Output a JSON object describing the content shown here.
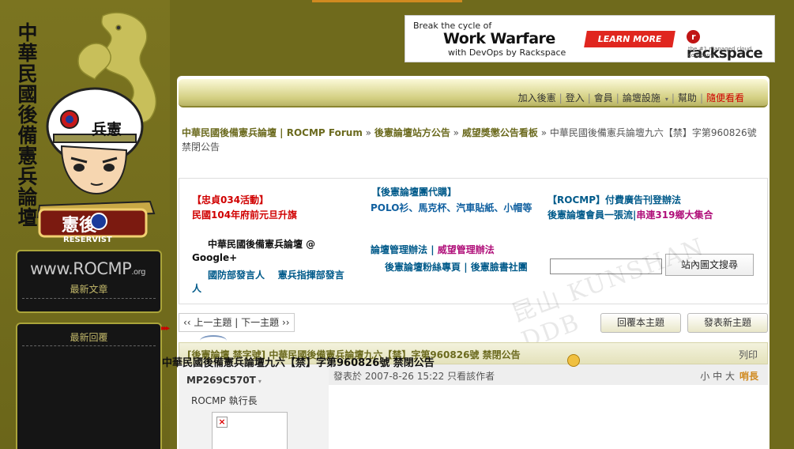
{
  "site": {
    "title": "中華民國後備憲兵論壇",
    "mascot_badge": "兵憲",
    "mascot_logo_text": "憲後",
    "mascot_banner": "RESERVIST",
    "logo_main": "www.ROCMP",
    "logo_suffix": ".org",
    "latest_posts": "最新文章",
    "latest_replies": "最新回覆"
  },
  "banner": {
    "line1": "Break the cycle of",
    "line2": "Work Warfare",
    "line3": "with DevOps by Rackspace",
    "cta": "LEARN MORE",
    "brand": "rackspace",
    "brand_mark": "r",
    "brand_tagline": "the #1 managed cloud company"
  },
  "nav": {
    "join": "加入後憲",
    "login": "登入",
    "members": "會員",
    "settings": "論壇設施",
    "help": "幫助",
    "random": "隨便看看"
  },
  "breadcrumb": {
    "home": "中華民國後備憲兵論壇 | ROCMP Forum",
    "sep": "»",
    "section1": "後憲論壇站方公告",
    "section2": "威望獎懲公告看板",
    "current": "中華民國後備憲兵論壇九六【禁】字第960826號 禁閉公告"
  },
  "notices": {
    "col1_head": "【忠貞034活動】",
    "col1_line": "民國104年府前元旦升旗",
    "col2_head": "【後憲論壇團代購】",
    "col2_line": "POLO衫、馬克杯、汽車貼紙、小帽等",
    "col3_head": "【ROCMP】付費廣告刊登辦法",
    "col3_line_a": "後憲論壇會員一張流",
    "col3_sep": "|",
    "col3_line_b": "串連319鄉大集合",
    "google": "中華民國後備憲兵論壇 @ Google+",
    "spokes_a": "國防部發言人",
    "spokes_b": "憲兵指揮部發言人",
    "rules_a": "論壇管理辦法",
    "rules_sep": "|",
    "rules_b": "威望管理辦法",
    "fans_a": "後憲論壇粉絲專頁",
    "fans_sep": "|",
    "fans_b": "後憲臉書社團",
    "search_button": "站內圖文搜尋",
    "search_value": ""
  },
  "watermark": "昆山 KUNSHAN DDB",
  "pager": {
    "prev": "‹‹ 上一主題",
    "sep": "|",
    "next": "下一主題 ››"
  },
  "actions": {
    "reply": "回覆本主題",
    "new_topic": "發表新主題"
  },
  "thread": {
    "title": "[後憲論壇 禁字號] 中華民國後備憲兵論壇九六【禁】字第960826號 禁閉公告",
    "print": "列印"
  },
  "post": {
    "author": "MP269C570T",
    "rank": "ROCMP 執行長",
    "meta": "發表於 2007-8-26 15:22 只看該作者",
    "size_small": "小",
    "size_mid": "中",
    "size_large": "大",
    "highlight": "哨長",
    "arrows": "▸▸▸",
    "title": "中華民國後備憲兵論壇九六【禁】字第960826號 禁閉公告"
  },
  "colors": {
    "background": "#6f6a1c",
    "accent_text": "#6b6a1e",
    "notice_red": "#d00000",
    "notice_blue": "#1060a0",
    "cta_red": "#e0261f"
  }
}
